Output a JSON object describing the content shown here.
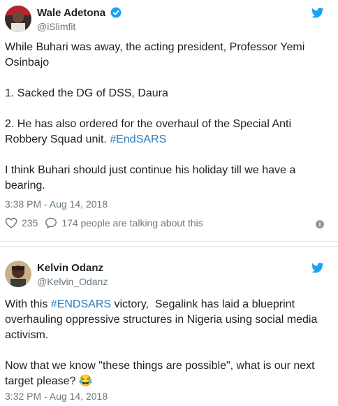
{
  "tweets": [
    {
      "author_name": "Wale Adetona",
      "handle": "@iSlimfit",
      "verified": true,
      "body_lines": [
        "While Buhari was away, the acting president, Professor Yemi",
        "Osinbajo",
        "1. Sacked the DG of DSS, Daura",
        "2. He has also ordered for the overhaul of the Special Anti",
        "Robbery Squad unit.",
        "#EndSARS",
        "I think Buhari should just continue his holiday till we have a",
        "bearing."
      ],
      "timestamp": "3:38 PM - Aug 14, 2018",
      "likes": "235",
      "replies_text": "174 people are talking about this",
      "info_icon": "i"
    },
    {
      "author_name": "Kelvin Odanz",
      "handle": "@Kelvin_Odanz",
      "verified": false,
      "body_lines": [
        "With this",
        "#ENDSARS",
        "victory,  Segalink has laid a blueprint",
        "overhauling oppressive structures in Nigeria using social media",
        "activism.",
        "Now that we know \"these things are possible\", what is our next",
        "target please?",
        "😂"
      ],
      "timestamp": "3:32 PM - Aug 14, 2018"
    }
  ],
  "colors": {
    "link": "#2b7bb9",
    "twitter_blue": "#1da1f2",
    "muted": "#697882",
    "text": "#1c2022"
  },
  "icons": [
    "twitter-bird-icon",
    "verified-badge-icon",
    "heart-icon",
    "reply-bubble-icon",
    "info-icon"
  ]
}
